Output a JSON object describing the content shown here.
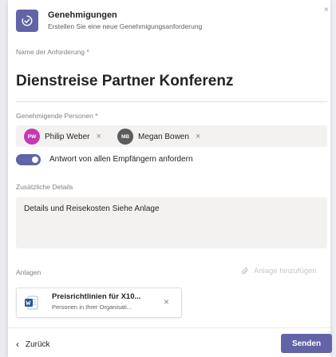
{
  "header": {
    "title": "Genehmigungen",
    "subtitle": "Erstellen Sie eine neue Genehmigungsanforderung",
    "icon": "approvals-app-icon"
  },
  "request_name": {
    "label": "Name der Anforderung *",
    "value": "Dienstreise Partner Konferenz"
  },
  "approvers": {
    "label": "Genehmigende Personen *",
    "people": [
      {
        "initials": "PW",
        "name": "Philip Weber",
        "color": "#c239b3"
      },
      {
        "initials": "MB",
        "name": "Megan Bowen",
        "color": "#5c5c5c"
      }
    ]
  },
  "response_toggle": {
    "label": "Antwort von allen Empfängern anfordern",
    "on": true
  },
  "details": {
    "label": "Zusätzliche Details",
    "value": "Details und Reisekosten Siehe Anlage"
  },
  "attachments": {
    "label": "Anlagen",
    "add_label": "Anlage hinzufügen",
    "files": [
      {
        "name": "Preisrichtlinien für X10...",
        "description": "Personen in Ihrer Organisati...",
        "type": "word-doc-icon"
      }
    ]
  },
  "footer": {
    "back_label": "Zurück",
    "send_label": "Senden"
  },
  "colors": {
    "accent": "#6264a7",
    "field_background": "#f3f2f1"
  }
}
